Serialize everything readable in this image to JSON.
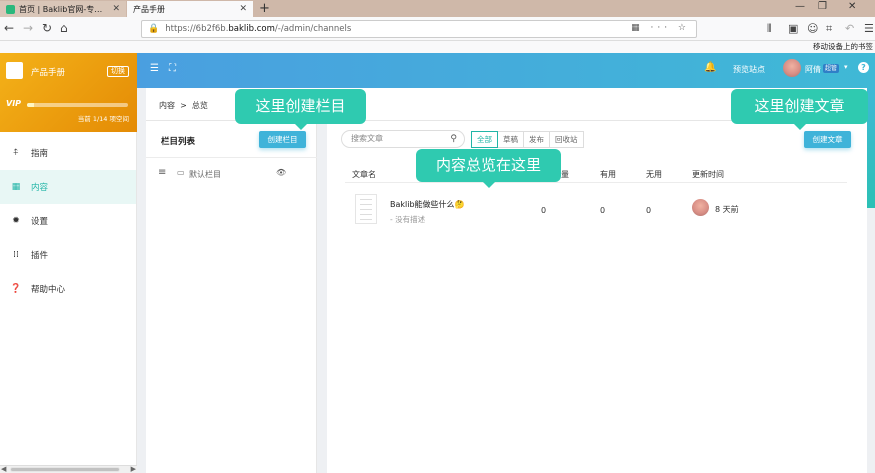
{
  "browser": {
    "tabs": [
      {
        "label": "首页 | Baklib官网-专业的知识库",
        "favicon_color": "#2ab87c"
      },
      {
        "label": "产品手册",
        "favicon_color": ""
      }
    ],
    "url_prefix": "https://6b2f6b.",
    "url_host": "baklib.com",
    "url_path": "/-/admin/channels",
    "mobile_bookmarks": "移动设备上的书签"
  },
  "brand": {
    "name": "产品手册",
    "switch_label": "切换",
    "vip": "VIP",
    "quota_text": "当前 1/14 项空间",
    "quota_fraction": 0.07,
    "accent": "#f4b219"
  },
  "menu": [
    {
      "label": "指南",
      "icon": "signpost-icon"
    },
    {
      "label": "内容",
      "icon": "grid-icon"
    },
    {
      "label": "设置",
      "icon": "gear-icon"
    },
    {
      "label": "插件",
      "icon": "apps-icon"
    },
    {
      "label": "帮助中心",
      "icon": "question-icon"
    }
  ],
  "header": {
    "preview_site": "预览站点",
    "user_name": "阿倩",
    "user_role": "超管",
    "help": "?"
  },
  "breadcrumb": {
    "root": "内容",
    "sep": ">",
    "current": "总览"
  },
  "channels": {
    "title": "栏目列表",
    "create_label": "创建栏目",
    "items": [
      {
        "name": "默认栏目"
      }
    ]
  },
  "articles": {
    "search_placeholder": "搜索文章",
    "filters": [
      "全部",
      "草稿",
      "发布",
      "回收站"
    ],
    "active_filter": "全部",
    "create_label": "创建文章",
    "columns": [
      "文章名",
      "量",
      "有用",
      "无用",
      "更新时间"
    ],
    "rows": [
      {
        "title": "Baklib能做些什么🤔",
        "desc": "- 没有描述",
        "views": "0",
        "useful": "0",
        "useless": "0",
        "updated": "8 天前"
      }
    ]
  },
  "callouts": {
    "create_column": "这里创建栏目",
    "create_article": "这里创建文章",
    "overview": "内容总览在这里"
  },
  "colors": {
    "teal": "#21b5a7",
    "header_start": "#4a9fe0",
    "header_end": "#3fb9d6",
    "button": "#3fb3d9",
    "callout": "#2fcab0"
  }
}
